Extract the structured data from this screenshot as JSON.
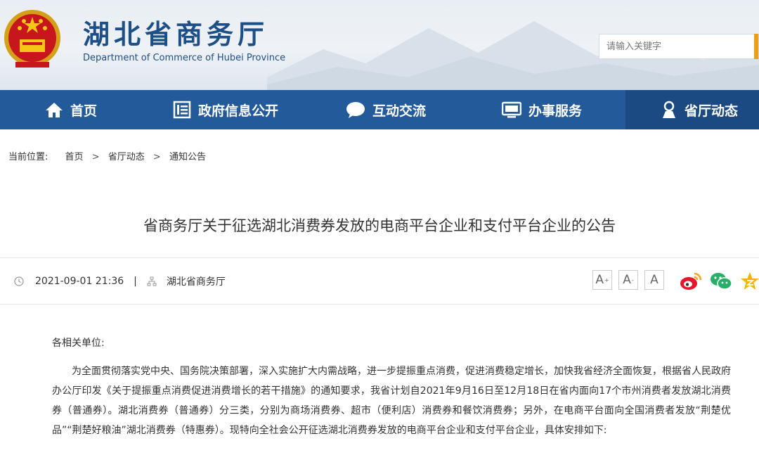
{
  "header": {
    "title": "湖北省商务厅",
    "subtitle": "Department of Commerce of Hubei Province",
    "search_placeholder": "请输入关键字"
  },
  "nav": {
    "items": [
      {
        "label": "首页",
        "icon": "home-icon"
      },
      {
        "label": "政府信息公开",
        "icon": "document-icon"
      },
      {
        "label": "互动交流",
        "icon": "chat-bubble-icon"
      },
      {
        "label": "办事服务",
        "icon": "monitor-icon"
      },
      {
        "label": "省厅动态",
        "icon": "news-person-icon"
      }
    ],
    "active_index": 4
  },
  "breadcrumb": {
    "prefix": "当前位置:",
    "items": [
      "首页",
      "省厅动态",
      "通知公告"
    ],
    "separator": ">"
  },
  "article": {
    "title": "省商务厅关于征选湖北消费券发放的电商平台企业和支付平台企业的公告",
    "datetime": "2021-09-01 21:36",
    "source": "湖北省商务厅",
    "font_buttons": [
      "A",
      "A",
      "A"
    ],
    "greeting": "各相关单位:",
    "paragraph": "为全面贯彻落实党中央、国务院决策部署，深入实施扩大内需战略，进一步提振重点消费，促进消费稳定增长，加快我省经济全面恢复，根据省人民政府办公厅印发《关于提振重点消费促进消费增长的若干措施》的通知要求，我省计划自2021年9月16日至12月18日在省内面向17个市州消费者发放湖北消费券（普通券）。湖北消费券（普通券）分三类，分别为商场消费券、超市（便利店）消费券和餐饮消费券；另外，在电商平台面向全国消费者发放“荆楚优品”“荆楚好粮油”湖北消费券（特惠券）。现特向全社会公开征选湖北消费券发放的电商平台企业和支付平台企业，具体安排如下:"
  },
  "share": [
    "weibo-icon",
    "wechat-icon",
    "qzone-icon"
  ],
  "colors": {
    "nav_bg": "#235a9a",
    "nav_active": "#1b4a82",
    "brand": "#1d4f86",
    "accent": "#f39c12"
  }
}
